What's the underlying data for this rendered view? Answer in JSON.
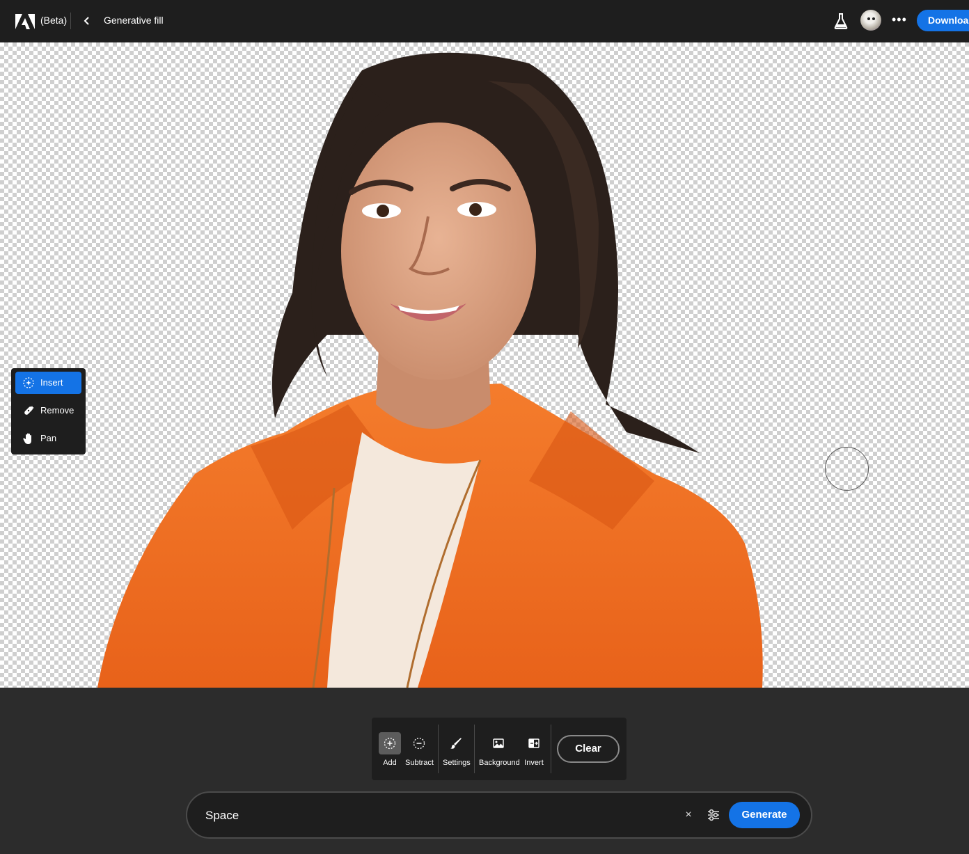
{
  "header": {
    "beta_label": "(Beta)",
    "title": "Generative fill",
    "download_label": "Download",
    "more_label": "•••"
  },
  "tool_menu": {
    "items": [
      {
        "label": "Insert",
        "icon": "insert-sparkle-icon",
        "active": true
      },
      {
        "label": "Remove",
        "icon": "remove-bandage-icon",
        "active": false
      },
      {
        "label": "Pan",
        "icon": "hand-icon",
        "active": false
      }
    ]
  },
  "toolbar": {
    "add_label": "Add",
    "subtract_label": "Subtract",
    "settings_label": "Settings",
    "background_label": "Background",
    "invert_label": "Invert",
    "clear_label": "Clear"
  },
  "prompt": {
    "value": "Space",
    "clear_label": "×",
    "generate_label": "Generate"
  },
  "colors": {
    "accent": "#1473e6",
    "topbar": "#1e1e1e",
    "panel": "#2c2c2c",
    "jacket": "#f07a2a"
  }
}
